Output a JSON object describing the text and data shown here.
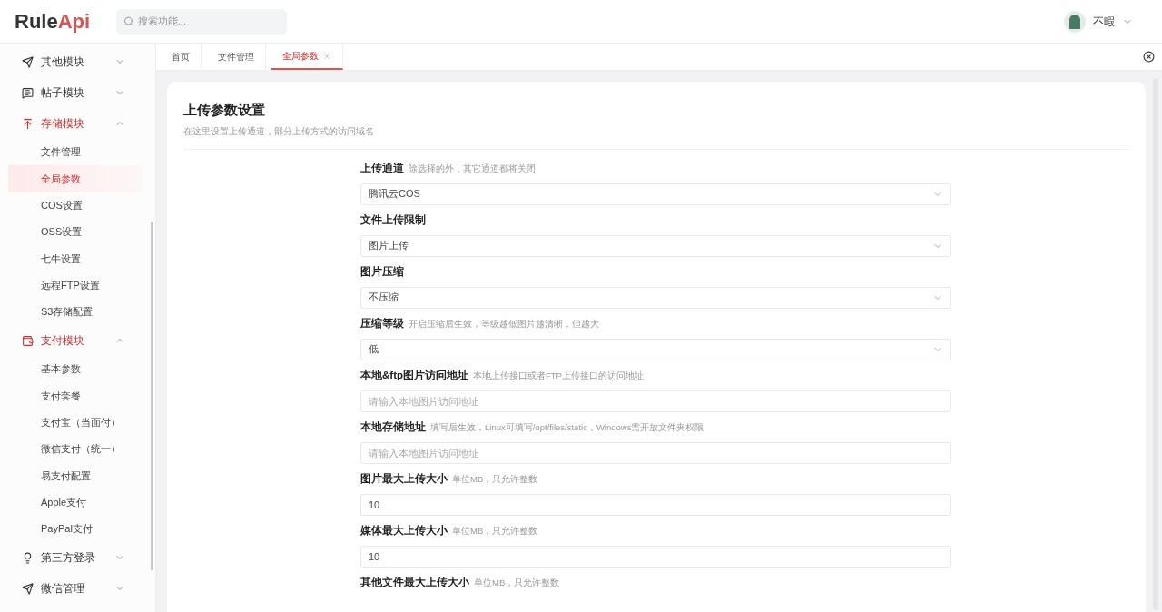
{
  "header": {
    "logo_dark": "Rule",
    "logo_accent": "Api",
    "search": {
      "placeholder": "搜索功能..."
    },
    "user": {
      "name": "不暇"
    }
  },
  "sidebar": {
    "groups": [
      {
        "label": "其他模块",
        "expanded": false,
        "active": false
      },
      {
        "label": "帖子模块",
        "expanded": false,
        "active": false
      },
      {
        "label": "存储模块",
        "expanded": true,
        "active": true,
        "children": [
          {
            "label": "文件管理",
            "selected": false
          },
          {
            "label": "全局参数",
            "selected": true
          },
          {
            "label": "COS设置",
            "selected": false
          },
          {
            "label": "OSS设置",
            "selected": false
          },
          {
            "label": "七牛设置",
            "selected": false
          },
          {
            "label": "远程FTP设置",
            "selected": false
          },
          {
            "label": "S3存储配置",
            "selected": false
          }
        ]
      },
      {
        "label": "支付模块",
        "expanded": true,
        "active": true,
        "children": [
          {
            "label": "基本参数",
            "selected": false
          },
          {
            "label": "支付套餐",
            "selected": false
          },
          {
            "label": "支付宝（当面付）",
            "selected": false
          },
          {
            "label": "微信支付（统一）",
            "selected": false
          },
          {
            "label": "易支付配置",
            "selected": false
          },
          {
            "label": "Apple支付",
            "selected": false
          },
          {
            "label": "PayPal支付",
            "selected": false
          }
        ]
      },
      {
        "label": "第三方登录",
        "expanded": false,
        "active": false
      },
      {
        "label": "微信管理",
        "expanded": false,
        "active": false
      }
    ]
  },
  "tabs": [
    {
      "label": "首页",
      "selected": false,
      "closable": false
    },
    {
      "label": "文件管理",
      "selected": false,
      "closable": false
    },
    {
      "label": "全局参数",
      "selected": true,
      "closable": true
    }
  ],
  "card": {
    "title": "上传参数设置",
    "subtitle": "在这里设置上传通道，部分上传方式的访问域名",
    "fields": [
      {
        "label": "上传通道",
        "hint": "除选择的外，其它通道都将关闭",
        "kind": "select",
        "value": "腾讯云COS"
      },
      {
        "label": "文件上传限制",
        "kind": "select",
        "value": "图片上传"
      },
      {
        "label": "图片压缩",
        "kind": "select",
        "value": "不压缩"
      },
      {
        "label": "压缩等级",
        "hint": "开启压缩后生效，等级越低图片越清晰，但越大",
        "kind": "select",
        "value": "低"
      },
      {
        "label": "本地&ftp图片访问地址",
        "hint": "本地上传接口或者FTP上传接口的访问地址",
        "kind": "input",
        "placeholder": "请输入本地图片访问地址"
      },
      {
        "label": "本地存储地址",
        "hint": "填写后生效，Linux可填写/opt/files/static，Windows需开放文件夹权限",
        "kind": "input",
        "placeholder": "请输入本地图片访问地址"
      },
      {
        "label": "图片最大上传大小",
        "hint": "单位MB，只允许整数",
        "kind": "input",
        "value": "10"
      },
      {
        "label": "媒体最大上传大小",
        "hint": "单位MB，只允许整数",
        "kind": "input",
        "value": "10"
      },
      {
        "label": "其他文件最大上传大小",
        "hint": "单位MB，只允许整数",
        "kind": "label"
      }
    ]
  }
}
